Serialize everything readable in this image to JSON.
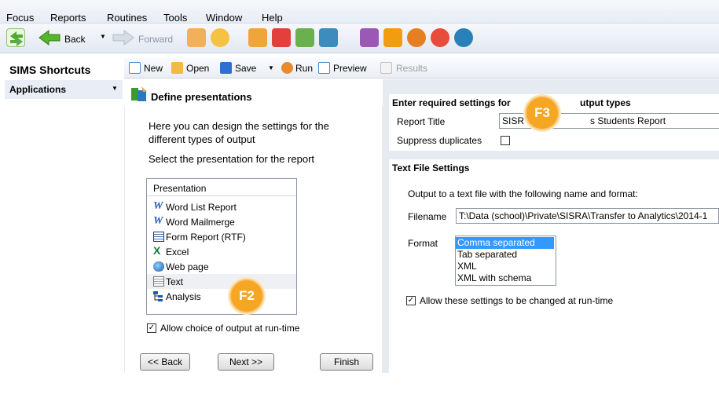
{
  "menu": [
    "Focus",
    "Reports",
    "Routines",
    "Tools",
    "Window",
    "Help"
  ],
  "nav": {
    "back": "Back",
    "forward": "Forward"
  },
  "shortcuts": {
    "title": "SIMS Shortcuts",
    "applications": "Applications"
  },
  "report_toolbar": {
    "new": "New",
    "open": "Open",
    "save": "Save",
    "run": "Run",
    "preview": "Preview",
    "results": "Results"
  },
  "wizard": {
    "title": "Define presentations",
    "intro": "Here you can design the settings for the different types of output",
    "select_prompt": "Select the presentation for the report",
    "list_header": "Presentation",
    "items": [
      {
        "label": "Word List Report",
        "icon": "word-icon"
      },
      {
        "label": "Word Mailmerge",
        "icon": "word-icon"
      },
      {
        "label": "Form Report (RTF)",
        "icon": "form-report-icon"
      },
      {
        "label": "Excel",
        "icon": "excel-icon"
      },
      {
        "label": "Web page",
        "icon": "globe-icon"
      },
      {
        "label": "Text",
        "icon": "text-file-icon"
      },
      {
        "label": "Analysis",
        "icon": "analysis-icon"
      }
    ],
    "allow_choice": "Allow choice of output at run-time",
    "buttons": {
      "back": "<< Back",
      "next": "Next >>",
      "finish": "Finish"
    }
  },
  "settings": {
    "required_title": "Enter required settings for",
    "required_title_tail": "utput types",
    "report_title_label": "Report Title",
    "report_title_value": "SISR",
    "report_title_value_tail": "s Students Report",
    "suppress_label": "Suppress duplicates",
    "text_file_title": "Text File Settings",
    "output_desc": "Output to a text file with the following name and format:",
    "filename_label": "Filename",
    "filename_value": "T:\\Data (school)\\Private\\SISRA\\Transfer to Analytics\\2014-1",
    "format_label": "Format",
    "formats": [
      "Comma separated",
      "Tab separated",
      "XML",
      "XML with schema"
    ],
    "selected_format": "Comma separated",
    "allow_change": "Allow these settings to be changed at run-time"
  },
  "callouts": {
    "f2": "F2",
    "f3": "F3"
  },
  "colors": {
    "accent": "#f5a623",
    "selection": "#3399ff",
    "panel": "#e6eaf1"
  }
}
